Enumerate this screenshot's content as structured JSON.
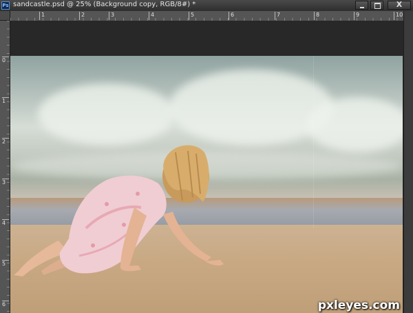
{
  "window": {
    "title": "sandcastle.psd @ 25% (Background copy, RGB/8#) *",
    "app_icon": "photoshop-icon",
    "controls": {
      "minimize": "minimize-icon",
      "maximize": "maximize-icon",
      "close": "close-icon",
      "close_glyph": "X"
    }
  },
  "rulers": {
    "horizontal": [
      "1",
      "2",
      "3",
      "4",
      "5",
      "6",
      "7",
      "8",
      "9",
      "10"
    ],
    "vertical": [
      "0",
      "1",
      "2",
      "3",
      "4",
      "5",
      "6"
    ]
  },
  "document": {
    "subject": "photo-girl-crawling-on-beach",
    "watermark": "pxleyes.com"
  }
}
